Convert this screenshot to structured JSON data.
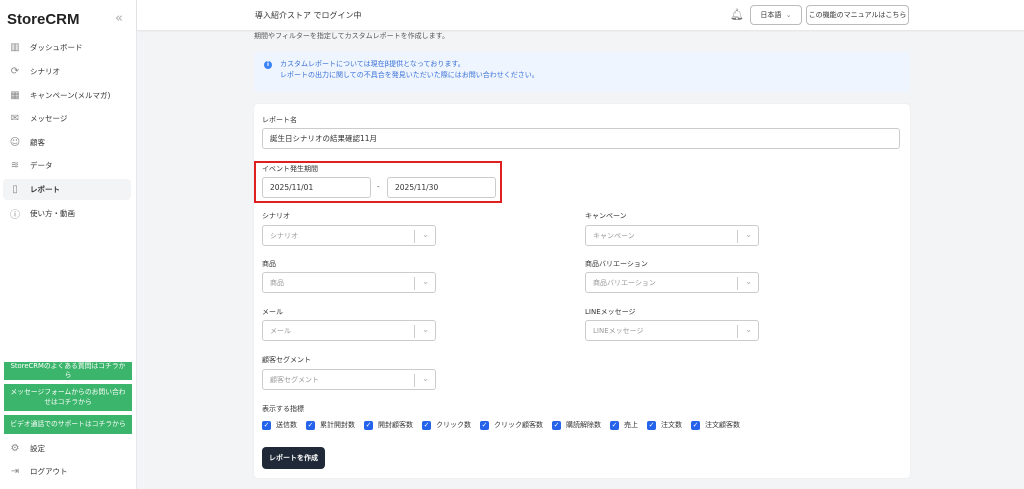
{
  "sidebar": {
    "logo": "StoreCRM",
    "collapse": "«",
    "items": [
      {
        "label": "ダッシュボード",
        "icon": "chart-icon"
      },
      {
        "label": "シナリオ",
        "icon": "refresh-icon"
      },
      {
        "label": "キャンペーン(メルマガ)",
        "icon": "calendar-icon"
      },
      {
        "label": "メッセージ",
        "icon": "mail-icon"
      },
      {
        "label": "顧客",
        "icon": "users-icon"
      },
      {
        "label": "データ",
        "icon": "database-icon"
      },
      {
        "label": "レポート",
        "icon": "document-icon"
      },
      {
        "label": "使い方・動画",
        "icon": "help-icon"
      }
    ],
    "support": [
      "StoreCRMのよくある質問はコチラから",
      "メッセージフォームからのお問い合わせはコチラから",
      "ビデオ通話でのサポートはコチラから"
    ],
    "settings": "設定",
    "logout": "ログアウト"
  },
  "header": {
    "title": "導入紹介ストア でログイン中",
    "language": "日本語",
    "manual": "この機能のマニュアルはこちら"
  },
  "page": {
    "subtitle": "期間やフィルターを指定してカスタムレポートを作成します。",
    "info_line1": "カスタムレポートについては現在β提供となっております。",
    "info_line2": "レポートの出力に関しての不具合を発見いただいた際にはお問い合わせください。"
  },
  "form": {
    "name_label": "レポート名",
    "name_value": "誕生日シナリオの結果確認11月",
    "period_label": "イベント発生期間",
    "start": "2025/11/01",
    "end": "2025/11/30",
    "dash": "-",
    "scenario_label": "シナリオ",
    "scenario_ph": "シナリオ",
    "campaign_label": "キャンペーン",
    "campaign_ph": "キャンペーン",
    "product_label": "商品",
    "product_ph": "商品",
    "variation_label": "商品バリエーション",
    "variation_ph": "商品バリエーション",
    "mail_label": "メール",
    "mail_ph": "メール",
    "line_label": "LINEメッセージ",
    "line_ph": "LINEメッセージ",
    "segment_label": "顧客セグメント",
    "segment_ph": "顧客セグメント",
    "metrics_label": "表示する指標",
    "metrics": [
      "送信数",
      "累計開封数",
      "開封顧客数",
      "クリック数",
      "クリック顧客数",
      "購読解除数",
      "売上",
      "注文数",
      "注文顧客数"
    ],
    "create": "レポートを作成"
  }
}
